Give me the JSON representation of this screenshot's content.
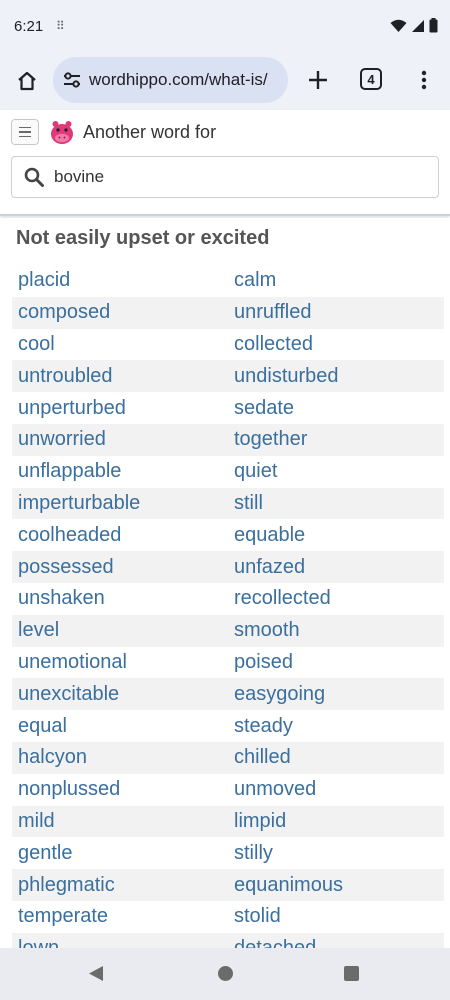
{
  "status_bar": {
    "time": "6:21"
  },
  "browser": {
    "url": "wordhippo.com/what-is/",
    "tab_count": "4"
  },
  "site": {
    "title": "Another word for",
    "search": {
      "value": "bovine",
      "placeholder": ""
    }
  },
  "content": {
    "heading": "Not easily upset or excited",
    "rows": [
      [
        "placid",
        "calm"
      ],
      [
        "composed",
        "unruffled"
      ],
      [
        "cool",
        "collected"
      ],
      [
        "untroubled",
        "undisturbed"
      ],
      [
        "unperturbed",
        "sedate"
      ],
      [
        "unworried",
        "together"
      ],
      [
        "unflappable",
        "quiet"
      ],
      [
        "imperturbable",
        "still"
      ],
      [
        "coolheaded",
        "equable"
      ],
      [
        "possessed",
        "unfazed"
      ],
      [
        "unshaken",
        "recollected"
      ],
      [
        "level",
        "smooth"
      ],
      [
        "unemotional",
        "poised"
      ],
      [
        "unexcitable",
        "easygoing"
      ],
      [
        "equal",
        "steady"
      ],
      [
        "halcyon",
        "chilled"
      ],
      [
        "nonplussed",
        "unmoved"
      ],
      [
        "mild",
        "limpid"
      ],
      [
        "gentle",
        "stilly"
      ],
      [
        "phlegmatic",
        "equanimous"
      ],
      [
        "temperate",
        "stolid"
      ],
      [
        "lown",
        "detached"
      ]
    ]
  },
  "colors": {
    "link": "#3a6f9e",
    "heading": "#555555",
    "alt_row": "#f2f2f2",
    "toolbar_bg": "#eef1f8"
  },
  "icons": {
    "status": [
      "wifi-icon",
      "signal-icon",
      "battery-icon"
    ],
    "toolbar": [
      "home-icon",
      "tune-icon",
      "plus-icon",
      "tab-switcher-icon",
      "more-vert-icon"
    ],
    "site": [
      "hamburger-icon",
      "hippo-logo-icon",
      "search-icon"
    ],
    "nav": [
      "back-icon",
      "home-circle-icon",
      "recents-icon"
    ]
  }
}
